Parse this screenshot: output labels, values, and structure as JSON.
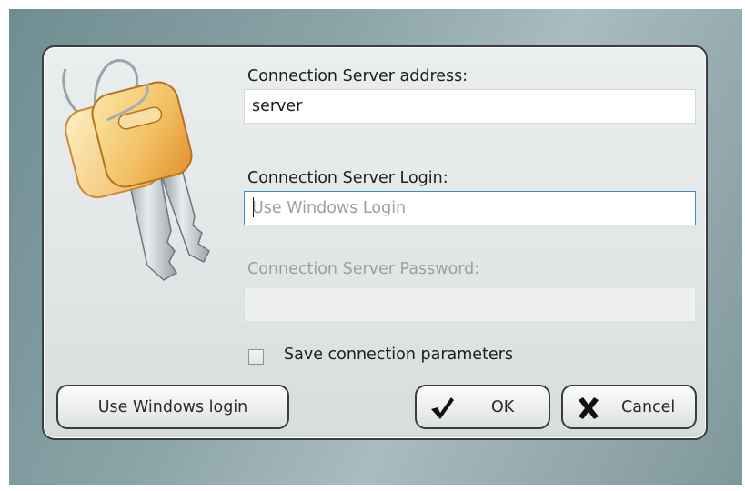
{
  "dialog": {
    "server_address": {
      "label": "Connection Server address:",
      "value": "server"
    },
    "server_login": {
      "label": "Connection Server Login:",
      "placeholder": "Use Windows Login"
    },
    "server_password": {
      "label": "Connection Server Password:",
      "disabled": true
    },
    "save_parameters": {
      "label": "Save connection parameters",
      "checked": false
    },
    "buttons": {
      "use_windows_login": "Use Windows login",
      "ok": "OK",
      "cancel": "Cancel"
    },
    "icons": {
      "art": "keys-icon",
      "ok": "checkmark-icon",
      "cancel": "x-icon"
    }
  }
}
